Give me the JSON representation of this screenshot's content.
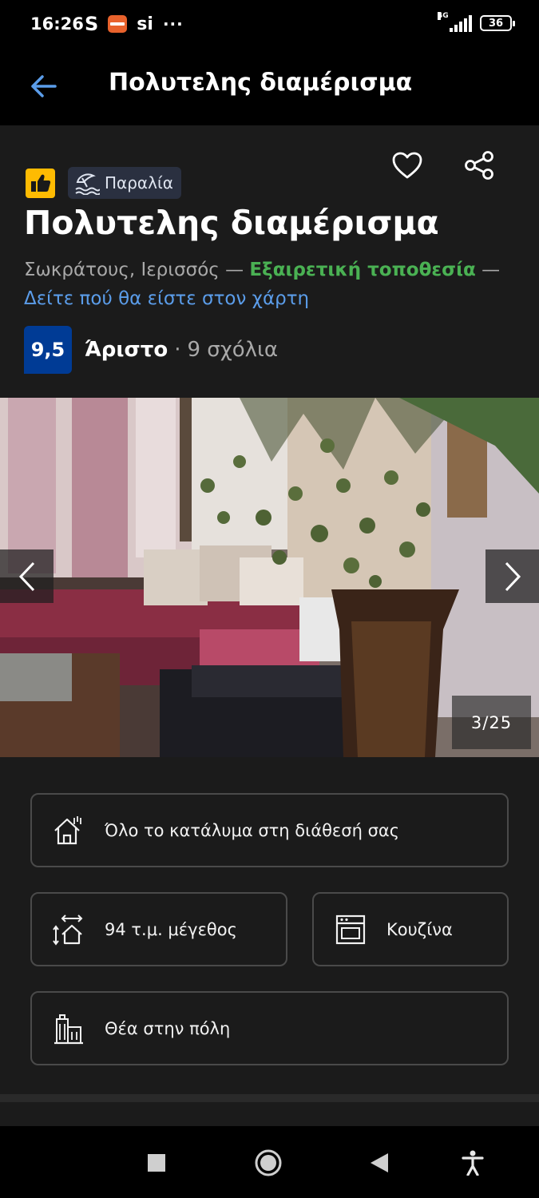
{
  "status_bar": {
    "time": "16:26",
    "s_label": "S",
    "si_label": "si",
    "more_dots": "···",
    "network": "4G",
    "battery": "36"
  },
  "app_bar": {
    "title": "Πολυτελης διαμέρισμα"
  },
  "property": {
    "beach_badge": "Παραλία",
    "name": "Πολυτελης διαμέρισμα",
    "address": "Σωκράτους, Ιερισσός",
    "dash1": " — ",
    "location_rating": "Εξαιρετική τοποθεσία",
    "dash2": " —",
    "map_link": "Δείτε πού θα είστε στον χάρτη",
    "score": "9,5",
    "score_label": "Άριστο",
    "separator": "·",
    "reviews": "9 σχόλια"
  },
  "gallery": {
    "counter": "3/25",
    "current": 3,
    "total": 25
  },
  "features": [
    {
      "label": "Όλο το κατάλυμα στη διάθεσή σας",
      "icon": "house-icon"
    },
    {
      "label": "94 τ.μ. μέγεθος",
      "icon": "size-icon"
    },
    {
      "label": "Κουζίνα",
      "icon": "kitchen-icon"
    },
    {
      "label": "Θέα στην πόλη",
      "icon": "city-icon"
    }
  ],
  "colors": {
    "score_bg": "#003b95",
    "location_green": "#4ab153",
    "link_blue": "#5b9dea",
    "thumb_yellow": "#febb02",
    "back_arrow": "#5b9dea"
  }
}
